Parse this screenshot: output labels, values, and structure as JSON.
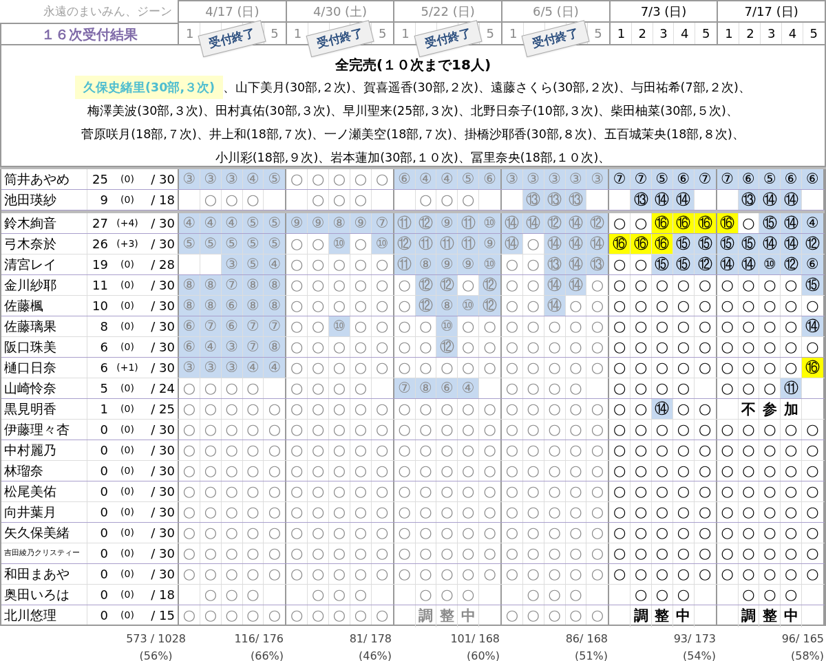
{
  "corner_note": "永遠のまいみん、ジーン",
  "title": "１６次受付結果",
  "events": [
    {
      "date": "4/17 (日)",
      "closed": true,
      "stamp": "受付終了",
      "slots": [
        "1",
        "5"
      ]
    },
    {
      "date": "4/30 (土)",
      "closed": true,
      "stamp": "受付終了",
      "slots": [
        "1",
        "5"
      ]
    },
    {
      "date": "5/22 (日)",
      "closed": true,
      "stamp": "受付終了",
      "slots": [
        "1",
        "5"
      ]
    },
    {
      "date": "6/5 (日)",
      "closed": true,
      "stamp": "受付終了",
      "slots": [
        "1",
        "5"
      ]
    },
    {
      "date": "7/3 (日)",
      "closed": false,
      "slots": [
        "1",
        "2",
        "3",
        "4",
        "5"
      ]
    },
    {
      "date": "7/17 (日)",
      "closed": false,
      "slots": [
        "1",
        "2",
        "3",
        "4",
        "5"
      ]
    }
  ],
  "summary": {
    "heading": "全完売(１０次まで18人)",
    "separator": "、",
    "lines": [
      [
        {
          "text": "久保史緒里(30部,３次)",
          "highlighted": true
        },
        {
          "text": "山下美月(30部,２次)",
          "highlighted": false
        },
        {
          "text": "賀喜遥香(30部,２次)",
          "highlighted": false
        },
        {
          "text": "遠藤さくら(30部,２次)",
          "highlighted": false
        },
        {
          "text": "与田祐希(7部,２次)",
          "highlighted": false
        }
      ],
      [
        {
          "text": "梅澤美波(30部,３次)",
          "highlighted": false
        },
        {
          "text": "田村真佑(30部,３次)",
          "highlighted": false
        },
        {
          "text": "早川聖来(25部,３次)",
          "highlighted": false
        },
        {
          "text": "北野日奈子(10部,３次)",
          "highlighted": false
        },
        {
          "text": "柴田柚菜(30部,５次)",
          "highlighted": false
        }
      ],
      [
        {
          "text": "菅原咲月(18部,７次)",
          "highlighted": false
        },
        {
          "text": "井上和(18部,７次)",
          "highlighted": false
        },
        {
          "text": "一ノ瀬美空(18部,７次)",
          "highlighted": false
        },
        {
          "text": "掛橋沙耶香(30部,８次)",
          "highlighted": false
        },
        {
          "text": "五百城茉央(18部,８次)",
          "highlighted": false
        }
      ],
      [
        {
          "text": "小川彩(18部,９次)",
          "highlighted": false
        },
        {
          "text": "岩本蓮加(30部,１０次)",
          "highlighted": false
        },
        {
          "text": "冨里奈央(18部,１０次)",
          "highlighted": false
        }
      ]
    ]
  },
  "sections": [
    {
      "groups": [
        [
          {
            "name": "筒井あやめ",
            "count": "25",
            "change": "(0)",
            "total": "/ 30",
            "cells": [
              {
                "text": "③",
                "color": "#c6d9f0"
              },
              {
                "text": "③",
                "color": "#c6d9f0"
              },
              {
                "text": "③",
                "color": "#c6d9f0"
              },
              {
                "text": "④",
                "color": "#c6d9f0"
              },
              {
                "text": "⑤",
                "color": "#c6d9f0"
              },
              "○",
              "○",
              "○",
              "○",
              "○",
              {
                "text": "⑥",
                "color": "#c6d9f0"
              },
              {
                "text": "④",
                "color": "#c6d9f0"
              },
              {
                "text": "④",
                "color": "#c6d9f0"
              },
              {
                "text": "⑤",
                "color": "#c6d9f0"
              },
              {
                "text": "⑥",
                "color": "#c6d9f0"
              },
              {
                "text": "③",
                "color": "#c6d9f0"
              },
              {
                "text": "③",
                "color": "#c6d9f0"
              },
              {
                "text": "③",
                "color": "#c6d9f0"
              },
              {
                "text": "③",
                "color": "#c6d9f0"
              },
              {
                "text": "③",
                "color": "#c6d9f0"
              },
              {
                "text": "⑦",
                "color": "#c6d9f0"
              },
              {
                "text": "⑦",
                "color": "#c6d9f0"
              },
              {
                "text": "⑤",
                "color": "#c6d9f0"
              },
              {
                "text": "⑥",
                "color": "#c6d9f0"
              },
              {
                "text": "⑦",
                "color": "#c6d9f0"
              },
              {
                "text": "⑦",
                "color": "#c6d9f0"
              },
              {
                "text": "⑥",
                "color": "#c6d9f0"
              },
              {
                "text": "⑤",
                "color": "#c6d9f0"
              },
              {
                "text": "⑥",
                "color": "#c6d9f0"
              },
              {
                "text": "⑥",
                "color": "#c6d9f0"
              }
            ]
          }
        ],
        [
          {
            "name": "池田瑛紗",
            "count": "9",
            "change": "(0)",
            "total": "/ 18",
            "cells": [
              null,
              "○",
              "○",
              "○",
              null,
              null,
              "○",
              "○",
              "○",
              null,
              null,
              "○",
              "○",
              "○",
              null,
              null,
              {
                "text": "⑬",
                "color": "#c6d9f0"
              },
              {
                "text": "⑬",
                "color": "#c6d9f0"
              },
              {
                "text": "⑬",
                "color": "#c6d9f0"
              },
              null,
              null,
              {
                "text": "⑬",
                "color": "#c6d9f0"
              },
              {
                "text": "⑭",
                "color": "#c6d9f0"
              },
              {
                "text": "⑭",
                "color": "#c6d9f0"
              },
              null,
              null,
              {
                "text": "⑬",
                "color": "#c6d9f0"
              },
              {
                "text": "⑭",
                "color": "#c6d9f0"
              },
              {
                "text": "⑭",
                "color": "#c6d9f0"
              },
              null
            ]
          }
        ]
      ]
    },
    {
      "groups": [
        [
          {
            "name": "鈴木絢音",
            "count": "27",
            "change": "(+4)",
            "total": "/ 30",
            "cells": [
              {
                "text": "④",
                "color": "#c6d9f0"
              },
              {
                "text": "④",
                "color": "#c6d9f0"
              },
              {
                "text": "④",
                "color": "#c6d9f0"
              },
              {
                "text": "⑤",
                "color": "#c6d9f0"
              },
              {
                "text": "⑤",
                "color": "#c6d9f0"
              },
              {
                "text": "⑨",
                "color": "#c6d9f0"
              },
              {
                "text": "⑨",
                "color": "#c6d9f0"
              },
              {
                "text": "⑧",
                "color": "#c6d9f0"
              },
              {
                "text": "⑨",
                "color": "#c6d9f0"
              },
              {
                "text": "⑦",
                "color": "#c6d9f0"
              },
              {
                "text": "⑪",
                "color": "#c6d9f0"
              },
              {
                "text": "⑫",
                "color": "#c6d9f0"
              },
              {
                "text": "⑨",
                "color": "#c6d9f0"
              },
              {
                "text": "⑪",
                "color": "#c6d9f0"
              },
              {
                "text": "⑩",
                "color": "#c6d9f0"
              },
              {
                "text": "⑭",
                "color": "#c6d9f0"
              },
              {
                "text": "⑭",
                "color": "#c6d9f0"
              },
              {
                "text": "⑫",
                "color": "#c6d9f0"
              },
              {
                "text": "⑭",
                "color": "#c6d9f0"
              },
              {
                "text": "⑫",
                "color": "#c6d9f0"
              },
              "○",
              "○",
              {
                "text": "⑯",
                "color": "#ffff00"
              },
              {
                "text": "⑯",
                "color": "#ffff00"
              },
              {
                "text": "⑯",
                "color": "#ffff00"
              },
              {
                "text": "⑯",
                "color": "#ffff00"
              },
              "○",
              {
                "text": "⑮",
                "color": "#c6d9f0"
              },
              {
                "text": "⑭",
                "color": "#c6d9f0"
              },
              {
                "text": "④",
                "color": "#c6d9f0"
              }
            ]
          }
        ],
        [
          {
            "name": "弓木奈於",
            "count": "26",
            "change": "(+3)",
            "total": "/ 30",
            "cells": [
              {
                "text": "⑤",
                "color": "#c6d9f0"
              },
              {
                "text": "⑤",
                "color": "#c6d9f0"
              },
              {
                "text": "⑤",
                "color": "#c6d9f0"
              },
              {
                "text": "⑤",
                "color": "#c6d9f0"
              },
              {
                "text": "⑤",
                "color": "#c6d9f0"
              },
              "○",
              "○",
              {
                "text": "⑩",
                "color": "#c6d9f0"
              },
              "○",
              {
                "text": "⑩",
                "color": "#c6d9f0"
              },
              {
                "text": "⑫",
                "color": "#c6d9f0"
              },
              {
                "text": "⑪",
                "color": "#c6d9f0"
              },
              {
                "text": "⑪",
                "color": "#c6d9f0"
              },
              {
                "text": "⑪",
                "color": "#c6d9f0"
              },
              {
                "text": "⑨",
                "color": "#c6d9f0"
              },
              {
                "text": "⑭",
                "color": "#c6d9f0"
              },
              "○",
              {
                "text": "⑭",
                "color": "#c6d9f0"
              },
              {
                "text": "⑭",
                "color": "#c6d9f0"
              },
              {
                "text": "⑭",
                "color": "#c6d9f0"
              },
              {
                "text": "⑯",
                "color": "#ffff00"
              },
              {
                "text": "⑯",
                "color": "#ffff00"
              },
              {
                "text": "⑯",
                "color": "#ffff00"
              },
              {
                "text": "⑮",
                "color": "#c6d9f0"
              },
              {
                "text": "⑮",
                "color": "#c6d9f0"
              },
              {
                "text": "⑮",
                "color": "#c6d9f0"
              },
              {
                "text": "⑮",
                "color": "#c6d9f0"
              },
              {
                "text": "⑭",
                "color": "#c6d9f0"
              },
              {
                "text": "⑭",
                "color": "#c6d9f0"
              },
              {
                "text": "⑫",
                "color": "#c6d9f0"
              }
            ]
          },
          {
            "name": "清宮レイ",
            "count": "19",
            "change": "(0)",
            "total": "/ 28",
            "cells": [
              null,
              null,
              {
                "text": "③",
                "color": "#c6d9f0"
              },
              {
                "text": "⑤",
                "color": "#c6d9f0"
              },
              {
                "text": "④",
                "color": "#c6d9f0"
              },
              "○",
              "○",
              "○",
              "○",
              "○",
              {
                "text": "⑪",
                "color": "#c6d9f0"
              },
              {
                "text": "⑧",
                "color": "#c6d9f0"
              },
              {
                "text": "⑨",
                "color": "#c6d9f0"
              },
              {
                "text": "⑨",
                "color": "#c6d9f0"
              },
              {
                "text": "⑩",
                "color": "#c6d9f0"
              },
              "○",
              "○",
              {
                "text": "⑬",
                "color": "#c6d9f0"
              },
              {
                "text": "⑭",
                "color": "#c6d9f0"
              },
              {
                "text": "⑬",
                "color": "#c6d9f0"
              },
              "○",
              "○",
              {
                "text": "⑮",
                "color": "#c6d9f0"
              },
              {
                "text": "⑮",
                "color": "#c6d9f0"
              },
              {
                "text": "⑫",
                "color": "#c6d9f0"
              },
              {
                "text": "⑭",
                "color": "#c6d9f0"
              },
              {
                "text": "⑭",
                "color": "#c6d9f0"
              },
              {
                "text": "⑩",
                "color": "#c6d9f0"
              },
              {
                "text": "⑫",
                "color": "#c6d9f0"
              },
              {
                "text": "⑥",
                "color": "#c6d9f0"
              }
            ]
          }
        ],
        [
          {
            "name": "金川紗耶",
            "count": "11",
            "change": "(0)",
            "total": "/ 30",
            "cells": [
              {
                "text": "⑧",
                "color": "#c6d9f0"
              },
              {
                "text": "⑧",
                "color": "#c6d9f0"
              },
              {
                "text": "⑦",
                "color": "#c6d9f0"
              },
              {
                "text": "⑧",
                "color": "#c6d9f0"
              },
              {
                "text": "⑧",
                "color": "#c6d9f0"
              },
              "○",
              "○",
              "○",
              "○",
              "○",
              "○",
              {
                "text": "⑫",
                "color": "#c6d9f0"
              },
              {
                "text": "⑫",
                "color": "#c6d9f0"
              },
              "○",
              {
                "text": "⑫",
                "color": "#c6d9f0"
              },
              "○",
              "○",
              {
                "text": "⑭",
                "color": "#c6d9f0"
              },
              {
                "text": "⑭",
                "color": "#c6d9f0"
              },
              "○",
              "○",
              "○",
              "○",
              "○",
              "○",
              "○",
              "○",
              "○",
              "○",
              {
                "text": "⑮",
                "color": "#c6d9f0"
              }
            ]
          },
          {
            "name": "佐藤楓",
            "count": "10",
            "change": "(0)",
            "total": "/ 30",
            "cells": [
              {
                "text": "⑧",
                "color": "#c6d9f0"
              },
              {
                "text": "⑧",
                "color": "#c6d9f0"
              },
              {
                "text": "⑥",
                "color": "#c6d9f0"
              },
              {
                "text": "⑧",
                "color": "#c6d9f0"
              },
              {
                "text": "⑧",
                "color": "#c6d9f0"
              },
              "○",
              "○",
              "○",
              "○",
              "○",
              "○",
              {
                "text": "⑫",
                "color": "#c6d9f0"
              },
              {
                "text": "⑧",
                "color": "#c6d9f0"
              },
              {
                "text": "⑩",
                "color": "#c6d9f0"
              },
              {
                "text": "⑫",
                "color": "#c6d9f0"
              },
              "○",
              "○",
              {
                "text": "⑭",
                "color": "#c6d9f0"
              },
              "○",
              "○",
              "○",
              "○",
              "○",
              "○",
              "○",
              "○",
              "○",
              "○",
              "○",
              "○"
            ]
          }
        ],
        [
          {
            "name": "佐藤璃果",
            "count": "8",
            "change": "(0)",
            "total": "/ 30",
            "cells": [
              {
                "text": "⑥",
                "color": "#c6d9f0"
              },
              {
                "text": "⑦",
                "color": "#c6d9f0"
              },
              {
                "text": "⑥",
                "color": "#c6d9f0"
              },
              {
                "text": "⑦",
                "color": "#c6d9f0"
              },
              {
                "text": "⑦",
                "color": "#c6d9f0"
              },
              "○",
              "○",
              {
                "text": "⑩",
                "color": "#c6d9f0"
              },
              "○",
              "○",
              "○",
              "○",
              {
                "text": "⑩",
                "color": "#c6d9f0"
              },
              "○",
              "○",
              "○",
              "○",
              "○",
              "○",
              "○",
              "○",
              "○",
              "○",
              "○",
              "○",
              "○",
              "○",
              "○",
              "○",
              {
                "text": "⑭",
                "color": "#c6d9f0"
              }
            ]
          },
          {
            "name": "阪口珠美",
            "count": "6",
            "change": "(0)",
            "total": "/ 30",
            "cells": [
              {
                "text": "⑥",
                "color": "#c6d9f0"
              },
              {
                "text": "④",
                "color": "#c6d9f0"
              },
              {
                "text": "③",
                "color": "#c6d9f0"
              },
              {
                "text": "⑦",
                "color": "#c6d9f0"
              },
              {
                "text": "⑧",
                "color": "#c6d9f0"
              },
              "○",
              "○",
              "○",
              "○",
              "○",
              "○",
              "○",
              {
                "text": "⑫",
                "color": "#c6d9f0"
              },
              "○",
              "○",
              "○",
              "○",
              "○",
              "○",
              "○",
              "○",
              "○",
              "○",
              "○",
              "○",
              "○",
              "○",
              "○",
              "○",
              "○"
            ]
          }
        ],
        [
          {
            "name": "樋口日奈",
            "count": "6",
            "change": "(+1)",
            "total": "/ 30",
            "cells": [
              {
                "text": "③",
                "color": "#c6d9f0"
              },
              {
                "text": "③",
                "color": "#c6d9f0"
              },
              {
                "text": "③",
                "color": "#c6d9f0"
              },
              {
                "text": "④",
                "color": "#c6d9f0"
              },
              {
                "text": "④",
                "color": "#c6d9f0"
              },
              "○",
              "○",
              "○",
              "○",
              "○",
              "○",
              "○",
              "○",
              "○",
              "○",
              "○",
              "○",
              "○",
              "○",
              "○",
              "○",
              "○",
              "○",
              "○",
              "○",
              "○",
              "○",
              "○",
              "○",
              {
                "text": "⑯",
                "color": "#ffff00"
              }
            ]
          },
          {
            "name": "山崎怜奈",
            "count": "5",
            "change": "(0)",
            "total": "/ 24",
            "cells": [
              "○",
              "○",
              "○",
              "○",
              null,
              "○",
              "○",
              "○",
              "○",
              null,
              {
                "text": "⑦",
                "color": "#c6d9f0"
              },
              {
                "text": "⑧",
                "color": "#c6d9f0"
              },
              {
                "text": "⑥",
                "color": "#c6d9f0"
              },
              {
                "text": "④",
                "color": "#c6d9f0"
              },
              null,
              "○",
              "○",
              "○",
              "○",
              null,
              "○",
              "○",
              "○",
              "○",
              null,
              "○",
              "○",
              "○",
              {
                "text": "⑪",
                "color": "#c6d9f0"
              },
              null
            ]
          }
        ],
        [
          {
            "name": "黒見明香",
            "count": "1",
            "change": "(0)",
            "total": "/ 25",
            "cells": [
              "○",
              "○",
              "○",
              "○",
              "○",
              "○",
              "○",
              "○",
              "○",
              "○",
              "○",
              "○",
              "○",
              "○",
              "○",
              "○",
              "○",
              "○",
              "○",
              "○",
              "○",
              "○",
              {
                "text": "⑭",
                "color": "#c6d9f0"
              },
              "○",
              "○",
              null,
              {
                "text": "不",
                "kind": "note"
              },
              {
                "text": "参",
                "kind": "note"
              },
              {
                "text": "加",
                "kind": "note"
              },
              null
            ]
          },
          {
            "name": "伊藤理々杏",
            "count": "0",
            "change": "(0)",
            "total": "/ 30",
            "cells": [
              "○",
              "○",
              "○",
              "○",
              "○",
              "○",
              "○",
              "○",
              "○",
              "○",
              "○",
              "○",
              "○",
              "○",
              "○",
              "○",
              "○",
              "○",
              "○",
              "○",
              "○",
              "○",
              "○",
              "○",
              "○",
              "○",
              "○",
              "○",
              "○",
              "○"
            ]
          }
        ],
        [
          {
            "name": "中村麗乃",
            "count": "0",
            "change": "(0)",
            "total": "/ 30",
            "cells": [
              "○",
              "○",
              "○",
              "○",
              "○",
              "○",
              "○",
              "○",
              "○",
              "○",
              "○",
              "○",
              "○",
              "○",
              "○",
              "○",
              "○",
              "○",
              "○",
              "○",
              "○",
              "○",
              "○",
              "○",
              "○",
              "○",
              "○",
              "○",
              "○",
              "○"
            ]
          },
          {
            "name": "林瑠奈",
            "count": "0",
            "change": "(0)",
            "total": "/ 30",
            "cells": [
              "○",
              "○",
              "○",
              "○",
              "○",
              "○",
              "○",
              "○",
              "○",
              "○",
              "○",
              "○",
              "○",
              "○",
              "○",
              "○",
              "○",
              "○",
              "○",
              "○",
              "○",
              "○",
              "○",
              "○",
              "○",
              "○",
              "○",
              "○",
              "○",
              "○"
            ]
          }
        ],
        [
          {
            "name": "松尾美佑",
            "count": "0",
            "change": "(0)",
            "total": "/ 30",
            "cells": [
              "○",
              "○",
              "○",
              "○",
              "○",
              "○",
              "○",
              "○",
              "○",
              "○",
              "○",
              "○",
              "○",
              "○",
              "○",
              "○",
              "○",
              "○",
              "○",
              "○",
              "○",
              "○",
              "○",
              "○",
              "○",
              "○",
              "○",
              "○",
              "○",
              "○"
            ]
          },
          {
            "name": "向井葉月",
            "count": "0",
            "change": "(0)",
            "total": "/ 30",
            "cells": [
              "○",
              "○",
              "○",
              "○",
              "○",
              "○",
              "○",
              "○",
              "○",
              "○",
              "○",
              "○",
              "○",
              "○",
              "○",
              "○",
              "○",
              "○",
              "○",
              "○",
              "○",
              "○",
              "○",
              "○",
              "○",
              "○",
              "○",
              "○",
              "○",
              "○"
            ]
          }
        ],
        [
          {
            "name": "矢久保美緒",
            "count": "0",
            "change": "(0)",
            "total": "/ 30",
            "cells": [
              "○",
              "○",
              "○",
              "○",
              "○",
              "○",
              "○",
              "○",
              "○",
              "○",
              "○",
              "○",
              "○",
              "○",
              "○",
              "○",
              "○",
              "○",
              "○",
              "○",
              "○",
              "○",
              "○",
              "○",
              "○",
              "○",
              "○",
              "○",
              "○",
              "○"
            ]
          },
          {
            "name": "吉田綾乃クリスティー",
            "count": "0",
            "change": "(0)",
            "total": "/ 30",
            "cells": [
              "○",
              "○",
              "○",
              "○",
              "○",
              "○",
              "○",
              "○",
              "○",
              "○",
              "○",
              "○",
              "○",
              "○",
              "○",
              "○",
              "○",
              "○",
              "○",
              "○",
              "○",
              "○",
              "○",
              "○",
              "○",
              "○",
              "○",
              "○",
              "○",
              "○"
            ]
          }
        ],
        [
          {
            "name": "和田まあや",
            "count": "0",
            "change": "(0)",
            "total": "/ 30",
            "cells": [
              "○",
              "○",
              "○",
              "○",
              "○",
              "○",
              "○",
              "○",
              "○",
              "○",
              "○",
              "○",
              "○",
              "○",
              "○",
              "○",
              "○",
              "○",
              "○",
              "○",
              "○",
              "○",
              "○",
              "○",
              "○",
              "○",
              "○",
              "○",
              "○",
              "○"
            ]
          },
          {
            "name": "奥田いろは",
            "count": "0",
            "change": "(0)",
            "total": "/ 18",
            "cells": [
              null,
              "○",
              "○",
              "○",
              null,
              null,
              "○",
              "○",
              "○",
              null,
              null,
              "○",
              "○",
              "○",
              null,
              null,
              "○",
              "○",
              "○",
              null,
              null,
              "○",
              "○",
              "○",
              null,
              null,
              "○",
              "○",
              "○",
              null
            ]
          }
        ],
        [
          {
            "name": "北川悠理",
            "count": "0",
            "change": "(0)",
            "total": "/ 15",
            "cells": [
              "○",
              "○",
              "○",
              "○",
              "○",
              "○",
              "○",
              "○",
              "○",
              "○",
              null,
              {
                "text": "調",
                "kind": "note"
              },
              {
                "text": "整",
                "kind": "note"
              },
              {
                "text": "中",
                "kind": "note"
              },
              null,
              "○",
              "○",
              "○",
              "○",
              "○",
              null,
              {
                "text": "調",
                "kind": "note"
              },
              {
                "text": "整",
                "kind": "note"
              },
              {
                "text": "中",
                "kind": "note"
              },
              null,
              null,
              {
                "text": "調",
                "kind": "note"
              },
              {
                "text": "整",
                "kind": "note"
              },
              {
                "text": "中",
                "kind": "note"
              },
              null
            ]
          }
        ]
      ]
    }
  ],
  "totals": {
    "overall": {
      "count": "573 / 1028",
      "percent": "(56%)"
    },
    "events": [
      {
        "count": "116/ 176",
        "percent": "(66%)"
      },
      {
        "count": "81/ 178",
        "percent": "(46%)"
      },
      {
        "count": "101/ 168",
        "percent": "(60%)"
      },
      {
        "count": "86/ 168",
        "percent": "(51%)"
      },
      {
        "count": "93/ 173",
        "percent": "(54%)"
      },
      {
        "count": "96/ 165",
        "percent": "(58%)"
      }
    ]
  }
}
